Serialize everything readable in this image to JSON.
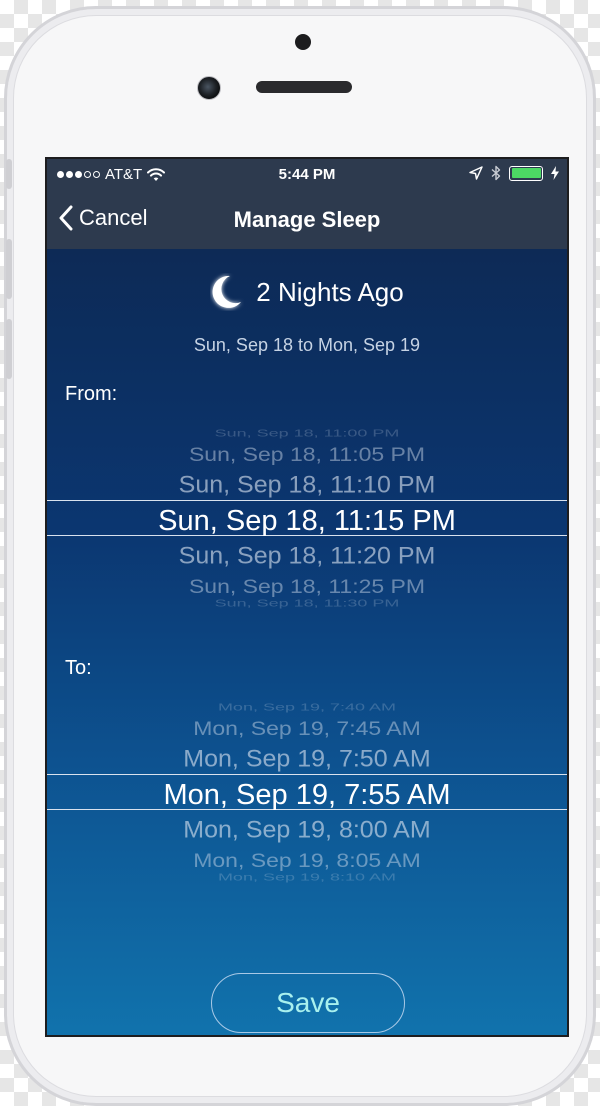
{
  "status_bar": {
    "carrier": "AT&T",
    "time": "5:44 PM",
    "battery_color": "#4cd964"
  },
  "nav": {
    "back_label": "Cancel",
    "title": "Manage Sleep"
  },
  "sleep": {
    "title": "2 Nights Ago",
    "date_range": "Sun, Sep 18 to Mon, Sep 19",
    "from_label": "From:",
    "to_label": "To:",
    "from_options": [
      "Sun, Sep 18, 11:00 PM",
      "Sun, Sep 18, 11:05 PM",
      "Sun, Sep 18, 11:10 PM",
      "Sun, Sep 18, 11:15 PM",
      "Sun, Sep 18, 11:20 PM",
      "Sun, Sep 18, 11:25 PM",
      "Sun, Sep 18, 11:30 PM"
    ],
    "to_options": [
      "Mon, Sep 19, 7:40 AM",
      "Mon, Sep 19, 7:45 AM",
      "Mon, Sep 19, 7:50 AM",
      "Mon, Sep 19, 7:55 AM",
      "Mon, Sep 19, 8:00 AM",
      "Mon, Sep 19, 8:05 AM",
      "Mon, Sep 19, 8:10 AM"
    ],
    "save_label": "Save"
  },
  "icons": {
    "back": "chevron-left-icon",
    "moon": "moon-icon",
    "wifi": "wifi-icon",
    "location": "location-arrow-icon",
    "bluetooth": "bluetooth-icon",
    "charging": "lightning-bolt-icon"
  }
}
